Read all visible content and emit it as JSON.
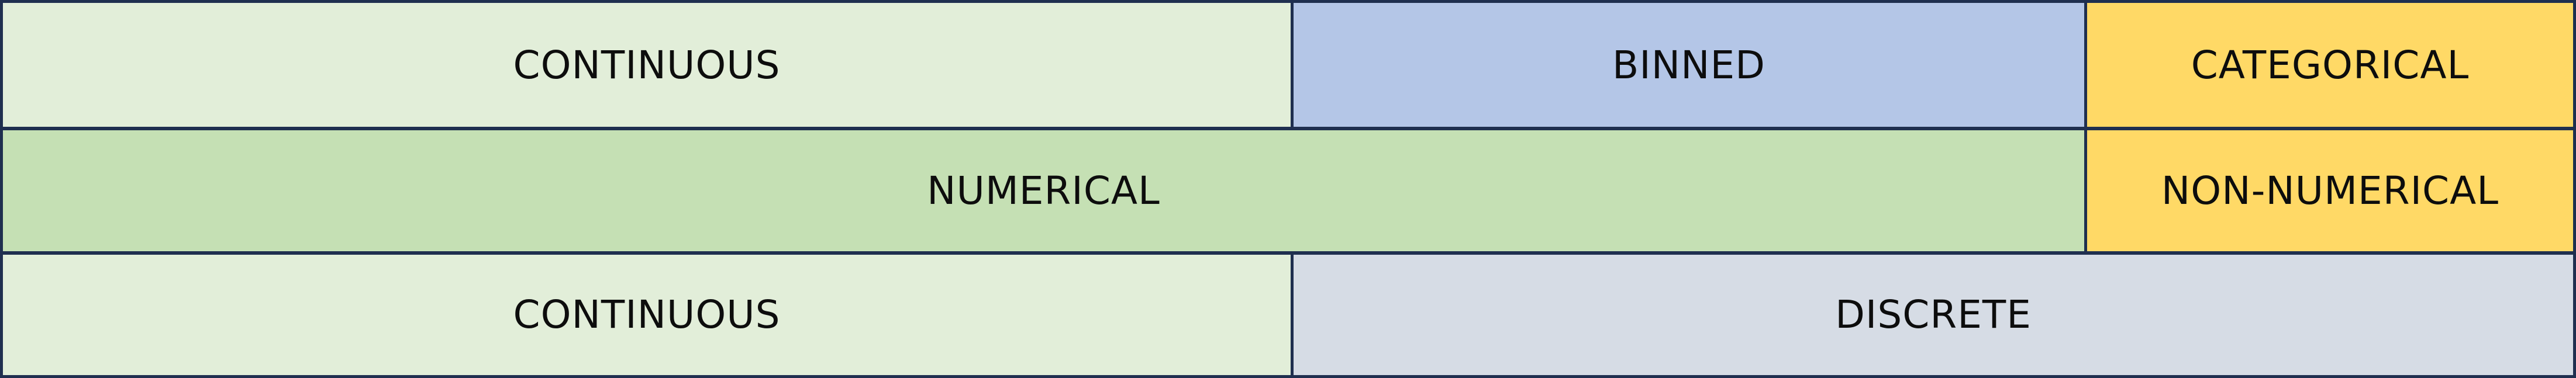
{
  "rows": [
    {
      "cells": [
        {
          "label": "CONTINUOUS",
          "color": "#e2eed9"
        },
        {
          "label": "BINNED",
          "color": "#b4c6e7"
        },
        {
          "label": "CATEGORICAL",
          "color": "#ffd966"
        }
      ]
    },
    {
      "cells": [
        {
          "label": "NUMERICAL",
          "color": "#c5e0b4"
        },
        {
          "label": "NON-NUMERICAL",
          "color": "#ffd966"
        }
      ]
    },
    {
      "cells": [
        {
          "label": "CONTINUOUS",
          "color": "#e2eed9"
        },
        {
          "label": "DISCRETE",
          "color": "#d6dce5"
        }
      ]
    }
  ],
  "border_color": "#1f2f4f"
}
